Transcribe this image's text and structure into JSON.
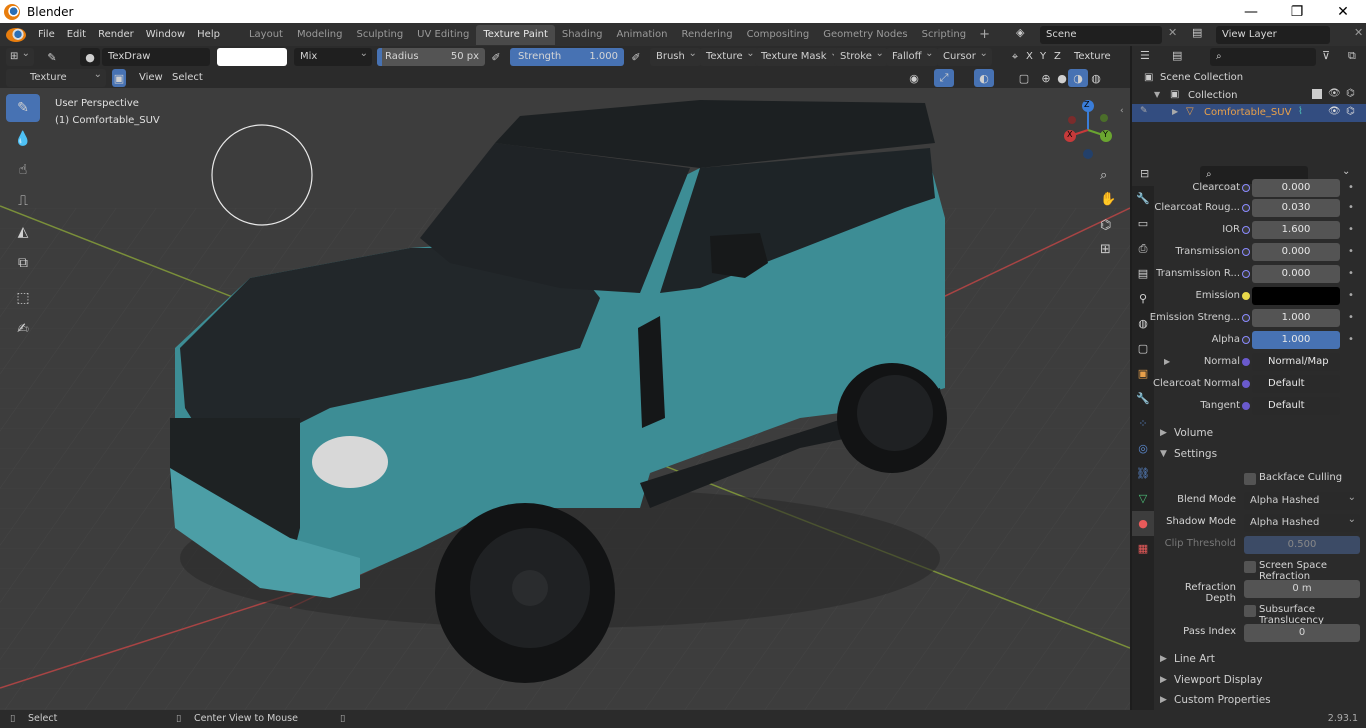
{
  "window": {
    "title": "Blender",
    "min": "—",
    "max": "❐",
    "close": "✕"
  },
  "menu": [
    "File",
    "Edit",
    "Render",
    "Window",
    "Help"
  ],
  "workspaces": [
    {
      "label": "Layout",
      "active": false
    },
    {
      "label": "Modeling",
      "active": false
    },
    {
      "label": "Sculpting",
      "active": false
    },
    {
      "label": "UV Editing",
      "active": false
    },
    {
      "label": "Texture Paint",
      "active": true
    },
    {
      "label": "Shading",
      "active": false
    },
    {
      "label": "Animation",
      "active": false
    },
    {
      "label": "Rendering",
      "active": false
    },
    {
      "label": "Compositing",
      "active": false
    },
    {
      "label": "Geometry Nodes",
      "active": false
    },
    {
      "label": "Scripting",
      "active": false
    }
  ],
  "scene": {
    "name": "Scene",
    "view_layer": "View Layer"
  },
  "tool_header": {
    "brush_name": "TexDraw",
    "blend_mode": "Mix",
    "radius_label": "Radius",
    "radius_value": "50 px",
    "strength_label": "Strength",
    "strength_value": "1.000",
    "menus": [
      "Brush",
      "Texture",
      "Texture Mask",
      "Stroke",
      "Falloff",
      "Cursor"
    ],
    "axes": [
      "X",
      "Y",
      "Z"
    ],
    "texture_slots": "Texture Slots"
  },
  "view_header": {
    "mode": "Texture Paint",
    "view": "View",
    "select": "Select"
  },
  "viewport": {
    "perspective": "User Perspective",
    "object": "(1) Comfortable_SUV"
  },
  "gizmo": {
    "x": "X",
    "y": "Y",
    "z": "Z"
  },
  "outliner": {
    "scene_collection": "Scene Collection",
    "collection": "Collection",
    "object": "Comfortable_SUV"
  },
  "properties": {
    "rows": [
      {
        "label": "Clearcoat",
        "value": "0.000",
        "style": "normal"
      },
      {
        "label": "Clearcoat Roug...",
        "value": "0.030",
        "style": "normal"
      },
      {
        "label": "IOR",
        "value": "1.600",
        "style": "normal"
      },
      {
        "label": "Transmission",
        "value": "0.000",
        "style": "normal"
      },
      {
        "label": "Transmission R...",
        "value": "0.000",
        "style": "normal"
      },
      {
        "label": "Emission",
        "value": "",
        "style": "color"
      },
      {
        "label": "Emission Streng...",
        "value": "1.000",
        "style": "normal"
      },
      {
        "label": "Alpha",
        "value": "1.000",
        "style": "blue"
      },
      {
        "label": "Normal",
        "value": "Normal/Map",
        "style": "dark"
      },
      {
        "label": "Clearcoat Normal",
        "value": "Default",
        "style": "dark"
      },
      {
        "label": "Tangent",
        "value": "Default",
        "style": "dark"
      }
    ],
    "volume": "Volume",
    "settings": "Settings",
    "backface_culling": "Backface Culling",
    "blend_mode_label": "Blend Mode",
    "blend_mode_value": "Alpha Hashed",
    "shadow_mode_label": "Shadow Mode",
    "shadow_mode_value": "Alpha Hashed",
    "clip_threshold_label": "Clip Threshold",
    "clip_threshold_value": "0.500",
    "screen_space_refraction": "Screen Space Refraction",
    "refraction_depth_label": "Refraction Depth",
    "refraction_depth_value": "0 m",
    "subsurface_translucency": "Subsurface Translucency",
    "pass_index_label": "Pass Index",
    "pass_index_value": "0",
    "line_art": "Line Art",
    "viewport_display": "Viewport Display",
    "custom_properties": "Custom Properties"
  },
  "status": {
    "select": "Select",
    "center_view": "Center View to Mouse",
    "version": "2.93.1"
  },
  "colors": {
    "accent": "#4772b3",
    "body_teal": "#3d8d95",
    "roof_dark": "#1f2427",
    "active_object": "#e8a04a"
  }
}
